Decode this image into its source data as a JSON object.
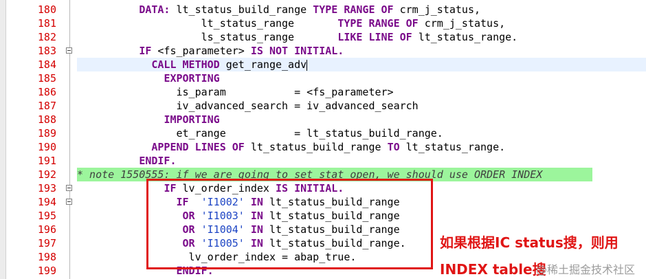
{
  "editor": {
    "lines": [
      {
        "num": "180",
        "fold": false,
        "tokens": [
          {
            "t": "kw",
            "v": "DATA:"
          },
          {
            "t": "plain",
            "v": " lt_status_build_range "
          },
          {
            "t": "kw",
            "v": "TYPE RANGE OF"
          },
          {
            "t": "plain",
            "v": " crm_j_status,"
          }
        ]
      },
      {
        "num": "181",
        "fold": false,
        "tokens": [
          {
            "t": "plain",
            "v": "      lt_status_range       "
          },
          {
            "t": "kw",
            "v": "TYPE RANGE OF"
          },
          {
            "t": "plain",
            "v": " crm_j_status,"
          }
        ]
      },
      {
        "num": "182",
        "fold": false,
        "tokens": [
          {
            "t": "plain",
            "v": "      ls_status_range       "
          },
          {
            "t": "kw",
            "v": "LIKE LINE OF"
          },
          {
            "t": "plain",
            "v": " lt_status_range."
          }
        ]
      },
      {
        "num": "183",
        "fold": true,
        "tokens": [
          {
            "t": "kw",
            "v": "IF"
          },
          {
            "t": "plain",
            "v": " <fs_parameter> "
          },
          {
            "t": "kw",
            "v": "IS NOT INITIAL."
          }
        ]
      },
      {
        "num": "184",
        "fold": false,
        "current": true,
        "tokens": [
          {
            "t": "plain",
            "v": "  "
          },
          {
            "t": "kw",
            "v": "CALL METHOD"
          },
          {
            "t": "plain",
            "v": " get_range_adv"
          }
        ]
      },
      {
        "num": "185",
        "fold": false,
        "tokens": [
          {
            "t": "plain",
            "v": "    "
          },
          {
            "t": "kw",
            "v": "EXPORTING"
          }
        ]
      },
      {
        "num": "186",
        "fold": false,
        "tokens": [
          {
            "t": "plain",
            "v": "      is_param           = <fs_parameter>"
          }
        ]
      },
      {
        "num": "187",
        "fold": false,
        "tokens": [
          {
            "t": "plain",
            "v": "      iv_advanced_search = iv_advanced_search"
          }
        ]
      },
      {
        "num": "188",
        "fold": false,
        "tokens": [
          {
            "t": "plain",
            "v": "    "
          },
          {
            "t": "kw",
            "v": "IMPORTING"
          }
        ]
      },
      {
        "num": "189",
        "fold": false,
        "tokens": [
          {
            "t": "plain",
            "v": "      et_range           = lt_status_build_range."
          }
        ]
      },
      {
        "num": "190",
        "fold": false,
        "tokens": [
          {
            "t": "plain",
            "v": "  "
          },
          {
            "t": "kw",
            "v": "APPEND LINES OF"
          },
          {
            "t": "plain",
            "v": " lt_status_build_range "
          },
          {
            "t": "kw",
            "v": "TO"
          },
          {
            "t": "plain",
            "v": " lt_status_range."
          }
        ]
      },
      {
        "num": "191",
        "fold": false,
        "tokens": [
          {
            "t": "kw",
            "v": "ENDIF."
          }
        ]
      },
      {
        "num": "192",
        "fold": false,
        "comment": true,
        "tokens": [
          {
            "t": "cm",
            "v": "* note 1550555: if we are going to set stat open, we should use ORDER INDEX"
          }
        ]
      },
      {
        "num": "193",
        "fold": true,
        "tokens": [
          {
            "t": "plain",
            "v": "    "
          },
          {
            "t": "kw",
            "v": "IF"
          },
          {
            "t": "plain",
            "v": " lv_order_index "
          },
          {
            "t": "kw",
            "v": "IS INITIAL."
          }
        ]
      },
      {
        "num": "194",
        "fold": true,
        "tokens": [
          {
            "t": "plain",
            "v": "      "
          },
          {
            "t": "kw",
            "v": "IF"
          },
          {
            "t": "plain",
            "v": "  "
          },
          {
            "t": "str",
            "v": "'I1002'"
          },
          {
            "t": "plain",
            "v": " "
          },
          {
            "t": "kw",
            "v": "IN"
          },
          {
            "t": "plain",
            "v": " lt_status_build_range"
          }
        ]
      },
      {
        "num": "195",
        "fold": false,
        "tokens": [
          {
            "t": "plain",
            "v": "       "
          },
          {
            "t": "kw",
            "v": "OR"
          },
          {
            "t": "plain",
            "v": " "
          },
          {
            "t": "str",
            "v": "'I1003'"
          },
          {
            "t": "plain",
            "v": " "
          },
          {
            "t": "kw",
            "v": "IN"
          },
          {
            "t": "plain",
            "v": " lt_status_build_range"
          }
        ]
      },
      {
        "num": "196",
        "fold": false,
        "tokens": [
          {
            "t": "plain",
            "v": "       "
          },
          {
            "t": "kw",
            "v": "OR"
          },
          {
            "t": "plain",
            "v": " "
          },
          {
            "t": "str",
            "v": "'I1004'"
          },
          {
            "t": "plain",
            "v": " "
          },
          {
            "t": "kw",
            "v": "IN"
          },
          {
            "t": "plain",
            "v": " lt_status_build_range"
          }
        ]
      },
      {
        "num": "197",
        "fold": false,
        "tokens": [
          {
            "t": "plain",
            "v": "       "
          },
          {
            "t": "kw",
            "v": "OR"
          },
          {
            "t": "plain",
            "v": " "
          },
          {
            "t": "str",
            "v": "'I1005'"
          },
          {
            "t": "plain",
            "v": " "
          },
          {
            "t": "kw",
            "v": "IN"
          },
          {
            "t": "plain",
            "v": " lt_status_build_range."
          }
        ]
      },
      {
        "num": "198",
        "fold": false,
        "tokens": [
          {
            "t": "plain",
            "v": "        lv_order_index = abap_true."
          }
        ]
      },
      {
        "num": "199",
        "fold": false,
        "tokens": [
          {
            "t": "plain",
            "v": "      "
          },
          {
            "t": "kw",
            "v": "ENDIF."
          }
        ]
      }
    ],
    "base_indent": [
      10,
      14,
      14,
      10,
      10,
      10,
      10,
      10,
      10,
      10,
      10,
      10,
      0,
      10,
      10,
      10,
      10,
      10,
      10,
      10
    ]
  },
  "annotation": {
    "line1": "如果根据IC status搜，则用",
    "line2": "INDEX table搜"
  },
  "watermark": "@稀土掘金技术社区",
  "colors": {
    "line_number": "#d40000",
    "keyword": "#7a0a8a",
    "string": "#1c44c4",
    "comment_bg": "#9cf59c",
    "current_line_bg": "#e8f2ff",
    "annotation": "#e01515"
  }
}
